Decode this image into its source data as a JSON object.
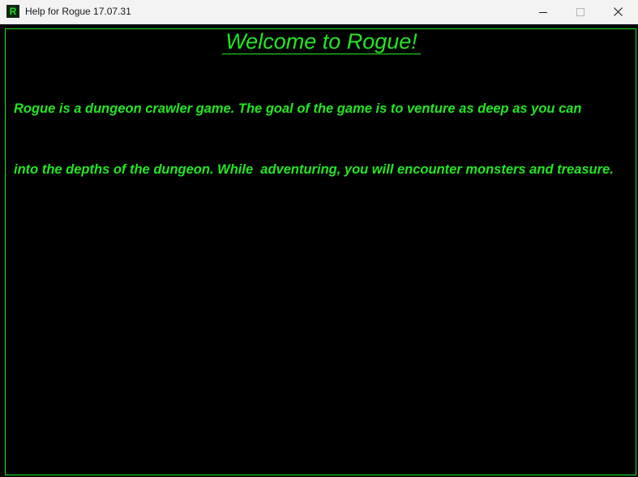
{
  "window": {
    "title": "Help for Rogue 17.07.31",
    "icon_letter": "R",
    "controls": [
      "minimize-icon",
      "maximize-icon",
      "close-icon"
    ]
  },
  "help": {
    "heading": "Welcome to Rogue!",
    "lines": [
      "Rogue is a dungeon crawler game. The goal of the game is to venture as deep as you can",
      "into the depths of the dungeon. While  adventuring, you will encounter monsters and treasure."
    ]
  },
  "colors": {
    "text": "#22e622",
    "background": "#000000",
    "titlebar": "#f3f3f3"
  }
}
